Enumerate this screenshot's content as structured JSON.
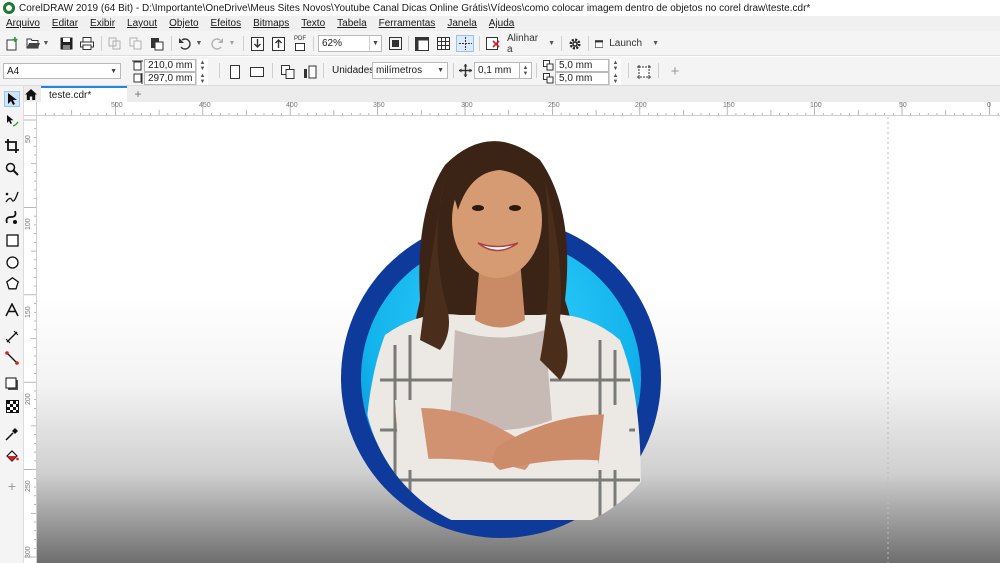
{
  "titlebar": {
    "title": "CorelDRAW 2019 (64 Bit) - D:\\Importante\\OneDrive\\Meus Sites Novos\\Youtube Canal Dicas Online Grátis\\Vídeos\\como colocar imagem dentro de objetos no corel draw\\teste.cdr*"
  },
  "menu": [
    "Arquivo",
    "Editar",
    "Exibir",
    "Layout",
    "Objeto",
    "Efeitos",
    "Bitmaps",
    "Texto",
    "Tabela",
    "Ferramentas",
    "Janela",
    "Ajuda"
  ],
  "toolbar": {
    "zoom": "62%",
    "align_label": "Alinhar a",
    "launch_label": "Launch",
    "pdf_label": "PDF"
  },
  "properties": {
    "page_size": "A4",
    "width": "210,0 mm",
    "height": "297,0 mm",
    "units_label": "Unidades:",
    "units_value": "milímetros",
    "nudge": "0,1 mm",
    "dup_x": "5,0 mm",
    "dup_y": "5,0 mm"
  },
  "tabs": {
    "document": "teste.cdr*"
  },
  "ruler": {
    "h_labels": [
      "500",
      "450",
      "400",
      "350",
      "300",
      "250",
      "200",
      "150",
      "100",
      "50",
      "0"
    ],
    "v_labels": [
      "50",
      "100",
      "150",
      "200",
      "250",
      "300"
    ]
  },
  "canvas": {
    "ring_outer_color": "#0d3a9b",
    "ring_inner_color": "#16b8ef",
    "image_description_icon": "woman-portrait"
  }
}
